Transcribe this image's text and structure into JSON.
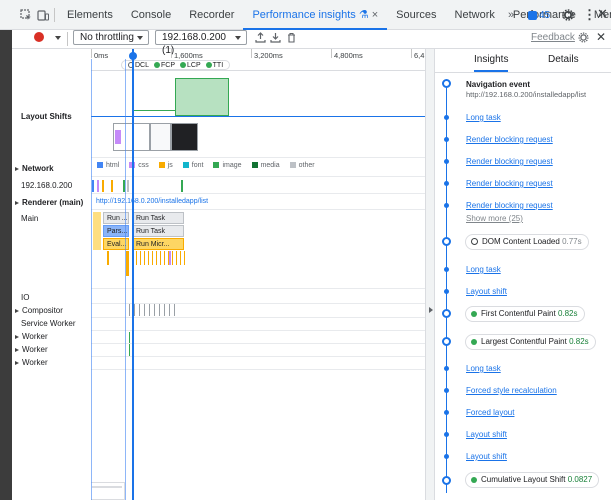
{
  "colors": {
    "accent": "#1a73e8",
    "record": "#d93025",
    "good": "#188038"
  },
  "tabs": [
    {
      "label": "Elements"
    },
    {
      "label": "Console"
    },
    {
      "label": "Recorder"
    },
    {
      "label": "Performance insights"
    },
    {
      "label": "Sources"
    },
    {
      "label": "Network"
    },
    {
      "label": "Performance"
    },
    {
      "label": "Memory"
    }
  ],
  "issues_count": "45",
  "toolbar": {
    "throttling": "No throttling",
    "recording": "192.168.0.200 (1)",
    "feedback": "Feedback"
  },
  "ruler": {
    "ticks": [
      "0ms",
      "1,600ms",
      "3,200ms",
      "4,800ms",
      "6,4"
    ],
    "markers": [
      {
        "label": "DCL",
        "color": "none"
      },
      {
        "label": "FCP",
        "color": "#34a853"
      },
      {
        "label": "LCP",
        "color": "#34a853"
      },
      {
        "label": "TTI",
        "color": "#34a853"
      }
    ]
  },
  "tracks": {
    "layout_shifts": "Layout Shifts",
    "network": "Network",
    "host": "192.168.0.200",
    "renderer": "Renderer (main)",
    "renderer_url": "http://192.168.0.200/installedapp/list",
    "main": "Main",
    "io": "IO",
    "compositor": "Compositor",
    "service_worker": "Service Worker",
    "worker1": "Worker",
    "worker2": "Worker",
    "worker3": "Worker"
  },
  "legend": [
    {
      "label": "html",
      "color": "#4285f4"
    },
    {
      "label": "css",
      "color": "#c58af9"
    },
    {
      "label": "js",
      "color": "#f9ab00"
    },
    {
      "label": "font",
      "color": "#12b5cb"
    },
    {
      "label": "image",
      "color": "#34a853"
    },
    {
      "label": "media",
      "color": "#137333"
    },
    {
      "label": "other",
      "color": "#bdc1c6"
    }
  ],
  "main_blocks": [
    {
      "label": "Run ...",
      "color": "#e8eaed"
    },
    {
      "label": "Run Task",
      "color": "#e8eaed"
    },
    {
      "label": "Pars...",
      "color": "#8ab4f8"
    },
    {
      "label": "Run Task",
      "color": "#e8eaed"
    },
    {
      "label": "Eval...",
      "color": "#fdd663"
    },
    {
      "label": "Run Micr...",
      "color": "#fdd663"
    }
  ],
  "panel": {
    "tabs": [
      "Insights",
      "Details"
    ],
    "nav_title": "Navigation event",
    "nav_url": "http://192.168.0.200/installedapp/list",
    "items": [
      {
        "type": "link",
        "label": "Long task"
      },
      {
        "type": "link",
        "label": "Render blocking request"
      },
      {
        "type": "link",
        "label": "Render blocking request"
      },
      {
        "type": "link",
        "label": "Render blocking request"
      },
      {
        "type": "link",
        "label": "Render blocking request"
      },
      {
        "type": "muted",
        "label": "Show more (25)"
      },
      {
        "type": "metric",
        "label": "DOM Content Loaded",
        "value": "0.77s",
        "dot": "none"
      },
      {
        "type": "link",
        "label": "Long task"
      },
      {
        "type": "link",
        "label": "Layout shift"
      },
      {
        "type": "metric",
        "label": "First Contentful Paint",
        "value": "0.82s",
        "dot": "#34a853"
      },
      {
        "type": "metric",
        "label": "Largest Contentful Paint",
        "value": "0.82s",
        "dot": "#34a853"
      },
      {
        "type": "link",
        "label": "Long task"
      },
      {
        "type": "link",
        "label": "Forced style recalculation"
      },
      {
        "type": "link",
        "label": "Forced layout"
      },
      {
        "type": "link",
        "label": "Layout shift"
      },
      {
        "type": "link",
        "label": "Layout shift"
      },
      {
        "type": "metric",
        "label": "Cumulative Layout Shift",
        "value": "0.0827",
        "dot": "#34a853"
      }
    ]
  }
}
